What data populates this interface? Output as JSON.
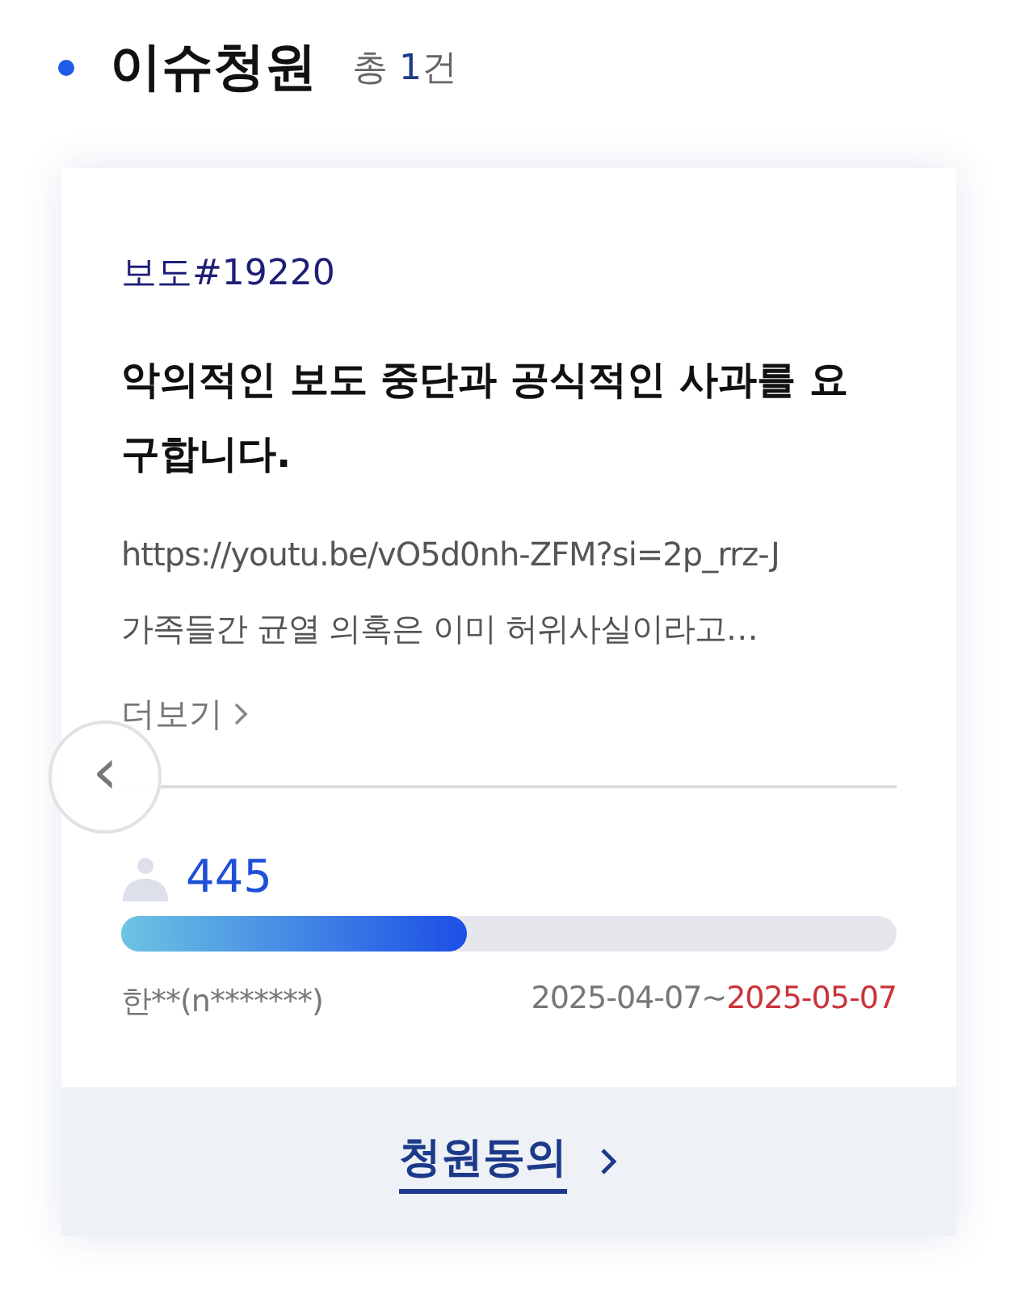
{
  "section": {
    "title": "이슈청원",
    "count_prefix": "총",
    "count": "1",
    "count_suffix": "건"
  },
  "petition": {
    "category": "보도#19220",
    "title": "악의적인 보도 중단과 공식적인 사과를 요구합니다.",
    "description_lines": [
      "https://youtu.be/vO5d0nh-ZFM?si=2p_rrz-J",
      "가족들간 균열 의혹은 이미 허위사실이라고…"
    ],
    "more_link": "더보기",
    "signatures": "445",
    "level": 0.445,
    "author": "한**(n*******)",
    "start_date": "2025-04-07",
    "separator": "~",
    "end_date": "2025-05-07"
  },
  "carousel": {
    "prev_arrow": "‹"
  },
  "action_button": "청원동의"
}
